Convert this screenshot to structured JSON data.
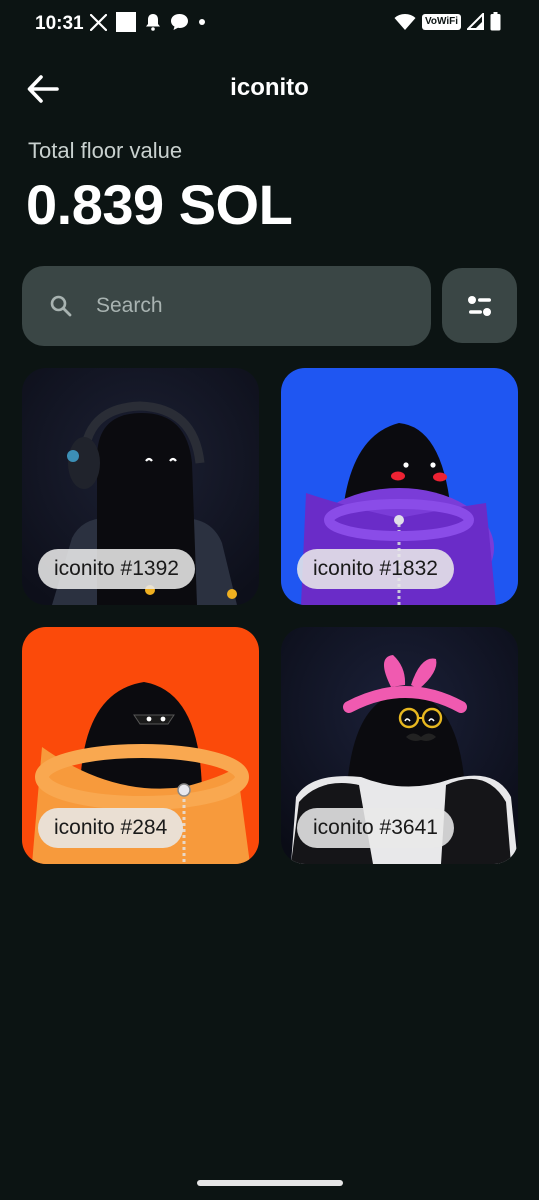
{
  "status_bar": {
    "time": "10:31",
    "wifi_label": "VoWiFi",
    "icons": [
      "x-icon",
      "square-icon",
      "bell-icon",
      "chat-bubble-icon",
      "dot-icon",
      "wifi-icon",
      "signal-icon",
      "battery-icon"
    ]
  },
  "app_bar": {
    "title": "iconito",
    "back_icon": "arrow-left-icon"
  },
  "summary": {
    "label": "Total floor value",
    "value": "0.839 SOL"
  },
  "search": {
    "placeholder": "Search",
    "value": ""
  },
  "filter": {
    "icon": "sliders-icon"
  },
  "collection": {
    "items": [
      {
        "label": "iconito #1392",
        "bg": "#15182a",
        "accent": "#3c8fb6"
      },
      {
        "label": "iconito #1832",
        "bg": "#1f56f2",
        "accent": "#7a3cd8"
      },
      {
        "label": "iconito #284",
        "bg": "#fb4a0a",
        "accent": "#f79a3c"
      },
      {
        "label": "iconito #3641",
        "bg": "#101422",
        "accent": "#f05ab0"
      }
    ]
  },
  "colors": {
    "background": "#0c1413",
    "surface": "#3a4645",
    "text_primary": "#ffffff",
    "text_secondary": "#c9d1cf"
  }
}
